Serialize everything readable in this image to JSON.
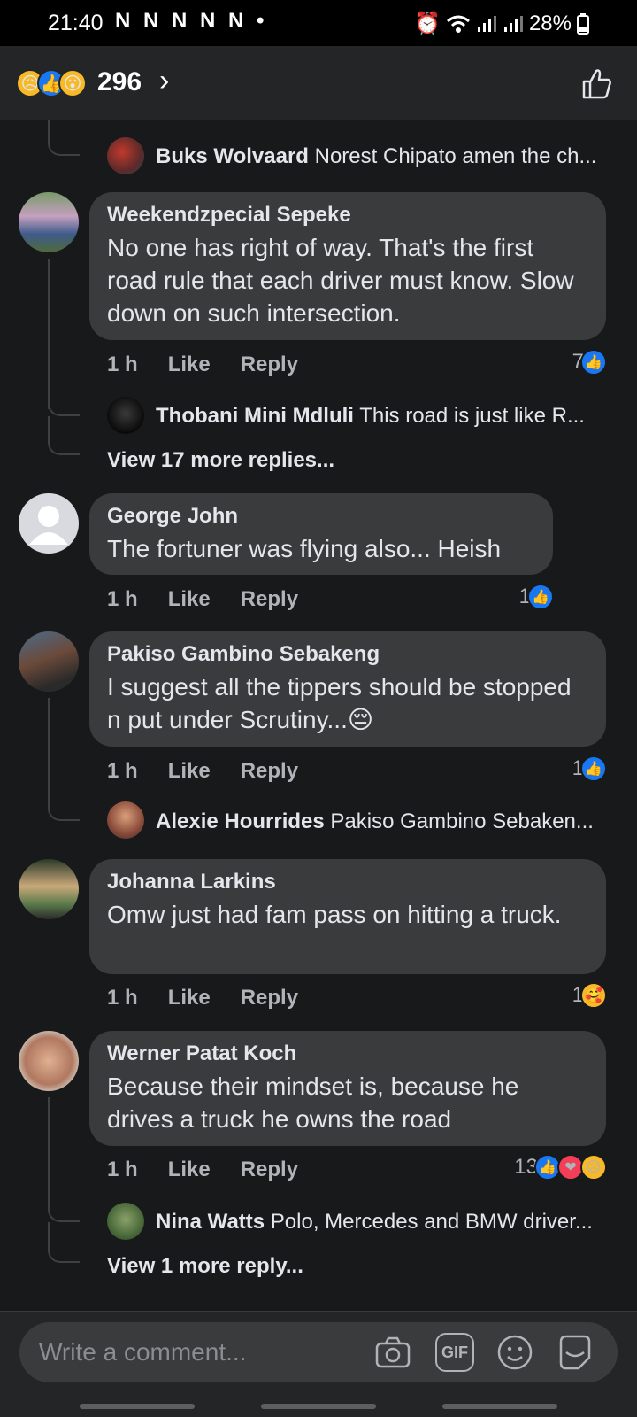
{
  "status": {
    "time": "21:40",
    "notifications": "N N N N N •",
    "battery": "28%"
  },
  "reactions": {
    "count": "296",
    "emojis": [
      "sad",
      "like",
      "wow"
    ]
  },
  "threads": [
    {
      "kind": "reply-preview",
      "name": "Buks Wolvaard",
      "text": "Norest Chipato amen the ch..."
    },
    {
      "kind": "comment",
      "name": "Weekendzpecial Sepeke",
      "text": "No one has right of way. That's the first road rule that each driver must know. Slow down on such intersection.",
      "time": "1 h",
      "like": "Like",
      "reply": "Reply",
      "reaction_count": "7",
      "reply_preview": {
        "name": "Thobani Mini Mdluli",
        "text": "This road is just like R..."
      },
      "view_more": "View 17 more replies..."
    },
    {
      "kind": "comment",
      "name": "George John",
      "text": "The fortuner was flying also... Heish",
      "time": "1 h",
      "like": "Like",
      "reply": "Reply",
      "reaction_count": "1"
    },
    {
      "kind": "comment",
      "name": "Pakiso Gambino Sebakeng",
      "text": "I suggest all the tippers  should be stopped n put under Scrutiny...😔",
      "time": "1 h",
      "like": "Like",
      "reply": "Reply",
      "reaction_count": "1",
      "reply_preview": {
        "name": "Alexie Hourrides",
        "text": "Pakiso Gambino Sebaken..."
      }
    },
    {
      "kind": "comment",
      "name": "Johanna Larkins",
      "text": "Omw just had fam pass on hitting a truck.",
      "time": "1 h",
      "like": "Like",
      "reply": "Reply",
      "reaction_count": "1"
    },
    {
      "kind": "comment",
      "name": "Werner Patat Koch",
      "text": "Because their mindset is, because he drives a truck he owns the road",
      "time": "1 h",
      "like": "Like",
      "reply": "Reply",
      "reaction_count": "13",
      "reply_preview": {
        "name": "Nina Watts",
        "text": "Polo, Mercedes and BMW driver..."
      },
      "view_more": "View 1 more reply..."
    }
  ],
  "composer": {
    "placeholder": "Write a comment...",
    "gif_label": "GIF"
  },
  "colors": {
    "background": "#18191a",
    "bubble": "#3a3b3c",
    "like_blue": "#1877f2",
    "love_red": "#f33e58"
  }
}
